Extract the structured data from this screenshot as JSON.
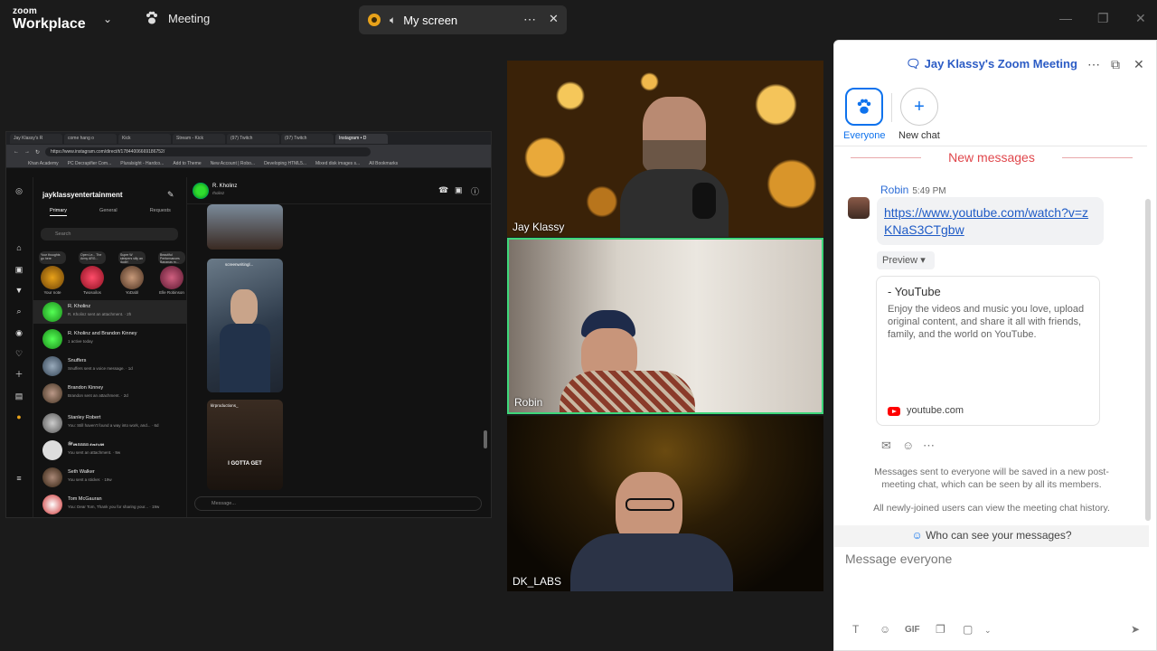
{
  "topbar": {
    "brand_line1": "zoom",
    "brand_line2": "Workplace",
    "meeting_label": "Meeting",
    "share_title": "My screen"
  },
  "browser": {
    "tabs": [
      "Jay Klassy's R",
      "come hang o",
      "Kick",
      "Stream - Kick",
      "(97) Twitch",
      "(97) Twitch",
      "Instagram • D"
    ],
    "url": "https://www.instagram.com/direct/t/17844006669186752/",
    "bookmarks": [
      "Khan Academy",
      "PC Decrapifier Com...",
      "Pluralsight - Hardco...",
      "Add to Theme",
      "New Account | Robo...",
      "Developing HTML5...",
      "Mixed disk images s...",
      "All Bookmarks"
    ]
  },
  "instagram": {
    "username": "jayklassyentertainment",
    "tabs": [
      "Primary",
      "General",
      "Requests"
    ],
    "search_placeholder": "Search",
    "notes": [
      {
        "text": "Your thoughts go here",
        "name": "Your note"
      },
      {
        "text": "Open Le... The Army ARG...",
        "name": "Twosoilos"
      },
      {
        "text": "Super W sleepers silly an dude!",
        "name": "YoDabl"
      },
      {
        "text": "Beautiful Performances Bananas m...",
        "name": "Elle Robinson"
      }
    ],
    "conversations": [
      {
        "name": "R. Kholinz",
        "msg": "R. Kholinz sent an attachment. · 2h"
      },
      {
        "name": "R. Kholinz and Brandon Kinney",
        "msg": "1 active today"
      },
      {
        "name": "Snuffers",
        "msg": "Snuffers sent a voice message. · 1d"
      },
      {
        "name": "Brandon Kinney",
        "msg": "Brandon sent an attachment. · 2d"
      },
      {
        "name": "Stanley Robert",
        "msg": "You: Still haven't found a way into work, and... · 6d"
      },
      {
        "name": "&#x1D4E6;&#x1D4F6;aaaa &#x1D4EE;&#x1D4F7;&#x1D4F8;&#x1D4FB;&#x1D4F6;",
        "msg": "You sent an attachment. · 9w"
      },
      {
        "name": "Seth Walker",
        "msg": "You sent a sticker. · 19w"
      },
      {
        "name": "Tom McGauran",
        "msg": "You: Dear Tom, Thank you for sharing your... · 19w"
      }
    ],
    "chat_name": "R. Kholinz",
    "chat_status": "rholinz",
    "media1_caption": "screenwritingl...",
    "media2_user": "klrproductions_",
    "media2_caption": "I GOTTA GET",
    "message_placeholder": "Message..."
  },
  "videos": {
    "tile1_name": "Jay Klassy",
    "tile2_name": "Robin",
    "tile3_name": "DK_LABS"
  },
  "chat": {
    "title": "Jay Klassy's Zoom Meeting",
    "everyone_label": "Everyone",
    "new_chat_label": "New chat",
    "new_messages": "New messages",
    "sender": "Robin",
    "time": "5:49 PM",
    "link": "https://www.youtube.com/watch?v=zKNaS3CTgbw",
    "preview_label": "Preview",
    "card_title": "- YouTube",
    "card_desc": "Enjoy the videos and music you love, upload original content, and share it all with friends, family, and the world on YouTube.",
    "card_site": "youtube.com",
    "note1": "Messages sent to everyone will be saved in a new post-meeting chat, which can be seen by all its members.",
    "note2": "All newly-joined users can view the meeting chat history.",
    "who_can_see": "Who can see your messages?",
    "input_placeholder": "Message everyone",
    "gif_label": "GIF"
  },
  "colors": {
    "accent_blue": "#0e72ed",
    "new_messages_red": "#e0474c",
    "active_speaker_green": "#3ed77a"
  }
}
